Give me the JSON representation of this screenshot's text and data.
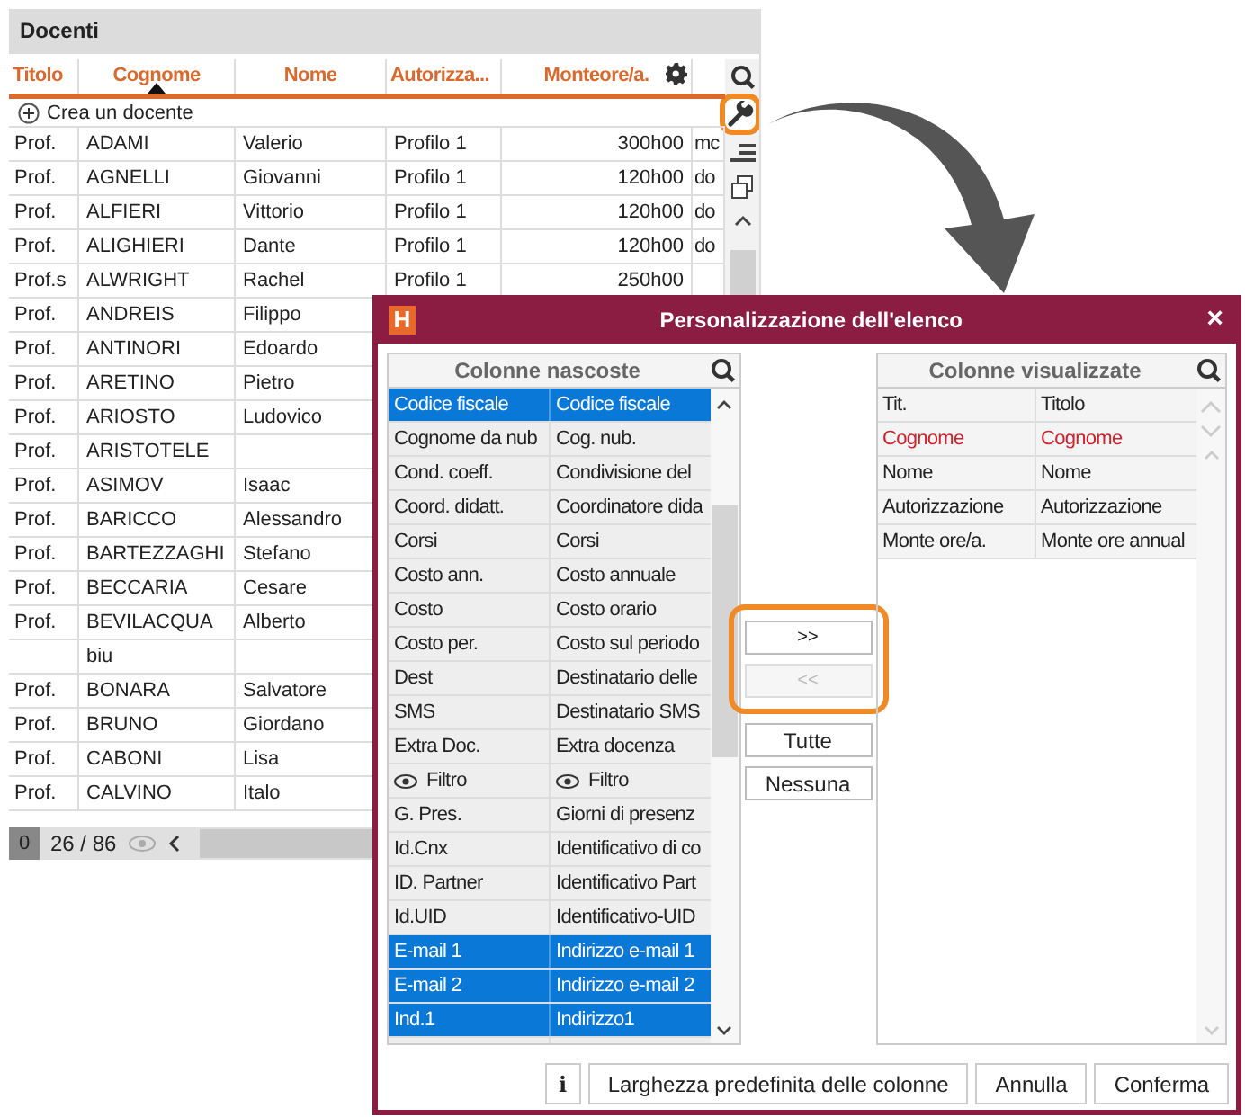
{
  "panel": {
    "title": "Docenti",
    "columns": [
      {
        "label": "Titolo",
        "sorted": false
      },
      {
        "label": "Cognome",
        "sorted": true
      },
      {
        "label": "Nome",
        "sorted": false
      },
      {
        "label": "Autorizza...",
        "sorted": false
      },
      {
        "label": "Monteore/a.",
        "sorted": false
      }
    ],
    "toolbar": [
      {
        "kind": "search",
        "circled": false
      },
      {
        "kind": "wrench",
        "circled": true
      },
      {
        "kind": "list",
        "circled": false
      },
      {
        "kind": "copy",
        "circled": false
      }
    ],
    "create_label": "Crea un docente",
    "rows": [
      {
        "titolo": "Prof.",
        "cognome": "ADAMI",
        "nome": "Valerio",
        "autorizzazione": "Profilo 1",
        "monteore": "300h00",
        "extra": "mc"
      },
      {
        "titolo": "Prof.",
        "cognome": "AGNELLI",
        "nome": "Giovanni",
        "autorizzazione": "Profilo 1",
        "monteore": "120h00",
        "extra": "do"
      },
      {
        "titolo": "Prof.",
        "cognome": "ALFIERI",
        "nome": "Vittorio",
        "autorizzazione": "Profilo 1",
        "monteore": "120h00",
        "extra": "do"
      },
      {
        "titolo": "Prof.",
        "cognome": "ALIGHIERI",
        "nome": "Dante",
        "autorizzazione": "Profilo 1",
        "monteore": "120h00",
        "extra": "do"
      },
      {
        "titolo": "Prof.s",
        "cognome": "ALWRIGHT",
        "nome": "Rachel",
        "autorizzazione": "Profilo 1",
        "monteore": "250h00"
      },
      {
        "titolo": "Prof.",
        "cognome": "ANDREIS",
        "nome": "Filippo"
      },
      {
        "titolo": "Prof.",
        "cognome": "ANTINORI",
        "nome": "Edoardo"
      },
      {
        "titolo": "Prof.",
        "cognome": "ARETINO",
        "nome": "Pietro"
      },
      {
        "titolo": "Prof.",
        "cognome": "ARIOSTO",
        "nome": "Ludovico"
      },
      {
        "titolo": "Prof.",
        "cognome": "ARISTOTELE"
      },
      {
        "titolo": "Prof.",
        "cognome": "ASIMOV",
        "nome": "Isaac"
      },
      {
        "titolo": "Prof.",
        "cognome": "BARICCO",
        "nome": "Alessandro"
      },
      {
        "titolo": "Prof.",
        "cognome": "BARTEZZAGHI",
        "nome": "Stefano"
      },
      {
        "titolo": "Prof.",
        "cognome": "BECCARIA",
        "nome": "Cesare"
      },
      {
        "titolo": "Prof.",
        "cognome": "BEVILACQUA",
        "nome": "Alberto"
      },
      {
        "cognome": "biu"
      },
      {
        "titolo": "Prof.",
        "cognome": "BONARA",
        "nome": "Salvatore"
      },
      {
        "titolo": "Prof.",
        "cognome": "BRUNO",
        "nome": "Giordano"
      },
      {
        "titolo": "Prof.",
        "cognome": "CABONI",
        "nome": "Lisa"
      },
      {
        "titolo": "Prof.",
        "cognome": "CALVINO",
        "nome": "Italo"
      }
    ],
    "footer": {
      "selected_count": "0",
      "count": "26 / 86"
    }
  },
  "dialog": {
    "logo": "H",
    "title": "Personalizzazione dell'elenco",
    "close": "×",
    "hidden_list": {
      "title": "Colonne nascoste",
      "rows": [
        {
          "short": "Codice fiscale",
          "long": "Codice fiscale",
          "kind": "text",
          "selected": true
        },
        {
          "short": "Cognome da nub",
          "long": "Cog. nub.",
          "kind": "text",
          "selected": false
        },
        {
          "short": "Cond. coeff.",
          "long": "Condivisione del",
          "kind": "text",
          "selected": false
        },
        {
          "short": "Coord. didatt.",
          "long": "Coordinatore dida",
          "kind": "text",
          "selected": false
        },
        {
          "short": "Corsi",
          "long": "Corsi",
          "kind": "text",
          "selected": false
        },
        {
          "short": "Costo ann.",
          "long": "Costo annuale",
          "kind": "text",
          "selected": false
        },
        {
          "short": "Costo",
          "long": "Costo orario",
          "kind": "text",
          "selected": false
        },
        {
          "short": "Costo per.",
          "long": "Costo sul periodo",
          "kind": "text",
          "selected": false
        },
        {
          "short": "Dest",
          "long": "Destinatario delle",
          "kind": "text",
          "selected": false
        },
        {
          "short": "SMS",
          "long": "Destinatario SMS",
          "kind": "text",
          "selected": false
        },
        {
          "short": "Extra Doc.",
          "long": "Extra docenza",
          "kind": "text",
          "selected": false
        },
        {
          "short": "Filtro",
          "long": "Filtro",
          "kind": "filter",
          "selected": false
        },
        {
          "short": "G. Pres.",
          "long": "Giorni di presenz",
          "kind": "text",
          "selected": false
        },
        {
          "short": "Id.Cnx",
          "long": "Identificativo di co",
          "kind": "text",
          "selected": false
        },
        {
          "short": "ID. Partner",
          "long": "Identificativo Part",
          "kind": "text",
          "selected": false
        },
        {
          "short": "Id.UID",
          "long": "Identificativo-UID",
          "kind": "text",
          "selected": false
        },
        {
          "short": "E-mail 1",
          "long": "Indirizzo e-mail 1",
          "kind": "text",
          "selected": true
        },
        {
          "short": "E-mail 2",
          "long": "Indirizzo e-mail 2",
          "kind": "text",
          "selected": true
        },
        {
          "short": "Ind.1",
          "long": "Indirizzo1",
          "kind": "text",
          "selected": true
        }
      ]
    },
    "move_buttons": {
      "circled": true,
      "add": {
        "label": ">>",
        "disabled": false
      },
      "remove": {
        "label": "<<",
        "disabled": true
      }
    },
    "all_button": "Tutte",
    "none_button": "Nessuna",
    "shown_list": {
      "title": "Colonne visualizzate",
      "rows": [
        {
          "short": "Tit.",
          "long": "Titolo",
          "highlighted": false
        },
        {
          "short": "Cognome",
          "long": "Cognome",
          "highlighted": true
        },
        {
          "short": "Nome",
          "long": "Nome",
          "highlighted": false
        },
        {
          "short": "Autorizzazione",
          "long": "Autorizzazione",
          "highlighted": false
        },
        {
          "short": "Monte ore/a.",
          "long": "Monte ore annual",
          "highlighted": false
        }
      ]
    },
    "info_button": "i",
    "default_width_button": "Larghezza predefinita delle colonne",
    "cancel_button": "Annulla",
    "confirm_button": "Conferma"
  }
}
